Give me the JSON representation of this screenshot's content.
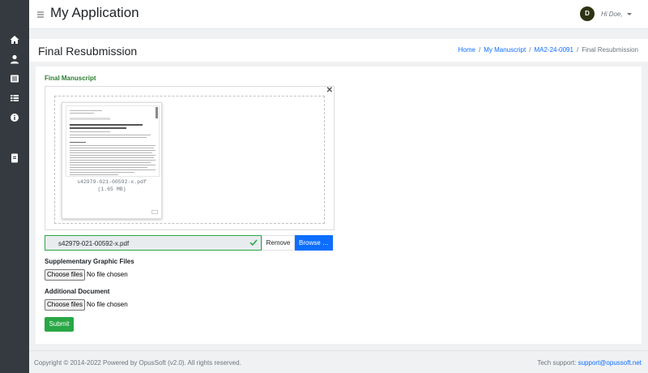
{
  "app": {
    "title": "My Application"
  },
  "sidebar": {
    "items": [
      {
        "icon": "home-icon"
      },
      {
        "icon": "user-icon"
      },
      {
        "icon": "list-alt-icon"
      },
      {
        "icon": "list-icon"
      },
      {
        "icon": "info-icon"
      },
      {
        "icon": "id-card-icon"
      }
    ]
  },
  "user": {
    "initial": "D",
    "greeting": "Hi Doe,"
  },
  "page": {
    "title": "Final Resubmission"
  },
  "breadcrumb": [
    {
      "label": "Home",
      "link": true
    },
    {
      "label": "My Manuscript",
      "link": true
    },
    {
      "label": "MA2-24-0091",
      "link": true
    },
    {
      "label": "Final Resubmission",
      "link": false
    }
  ],
  "manuscript": {
    "section_label": "Final Manuscript",
    "file_name": "s42979-021-00592-x.pdf",
    "file_size": "(1.65 MB)",
    "caption": "s42979-021-00592-x.pdf",
    "remove_label": "Remove",
    "browse_label": "Browse …"
  },
  "supplementary": {
    "label": "Supplementary Graphic Files",
    "button": "Choose files",
    "status": "No file chosen"
  },
  "additional": {
    "label": "Additional Document",
    "button": "Choose files",
    "status": "No file chosen"
  },
  "form": {
    "submit_label": "Submit"
  },
  "footer": {
    "copyright": "Copyright © 2014-2022 Powered by OpusSoft (v2.0). All rights reserved.",
    "support_label": "Tech support:",
    "support_email": "support@opussoft.net"
  },
  "colors": {
    "sidebar": "#343a40",
    "accent": "#0d6efd",
    "success": "#28a745",
    "section_label": "#2e7d32"
  }
}
